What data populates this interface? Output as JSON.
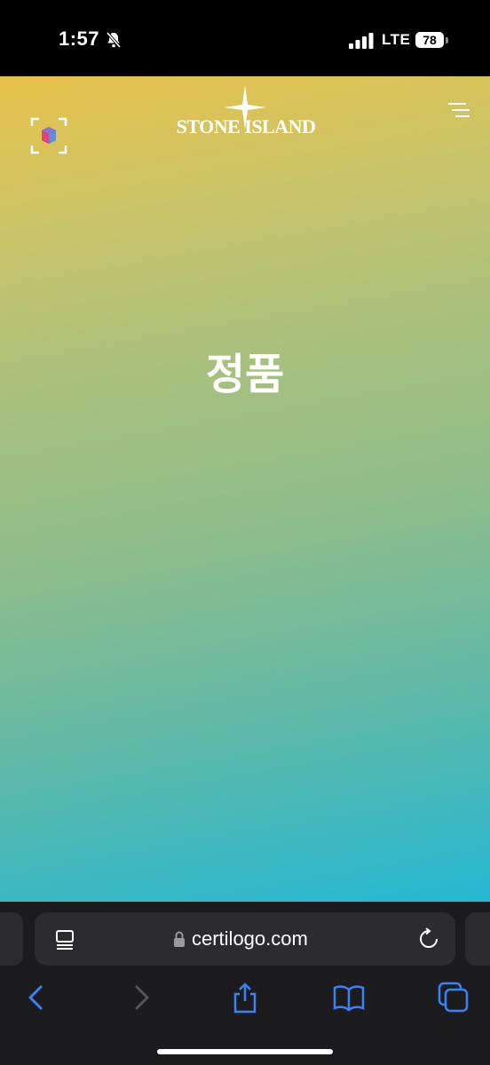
{
  "status_bar": {
    "time": "1:57",
    "network": "LTE",
    "battery": "78"
  },
  "page": {
    "brand": "STONE ISLAND",
    "verdict": "정품",
    "colors": {
      "gradient_top": "#e8c24a",
      "gradient_bottom": "#25b8d3"
    }
  },
  "browser": {
    "url": "certilogo.com",
    "accent_color": "#3b82f6"
  },
  "icons": {
    "status": [
      "bell-slash-icon",
      "signal-icon",
      "battery-icon"
    ],
    "page": [
      "scan-icon",
      "compass-star-icon",
      "hamburger-menu-icon"
    ],
    "url_bar": [
      "reader-icon",
      "lock-icon",
      "reload-icon"
    ],
    "toolbar": [
      "back-icon",
      "forward-icon",
      "share-icon",
      "bookmarks-icon",
      "tabs-icon"
    ]
  }
}
